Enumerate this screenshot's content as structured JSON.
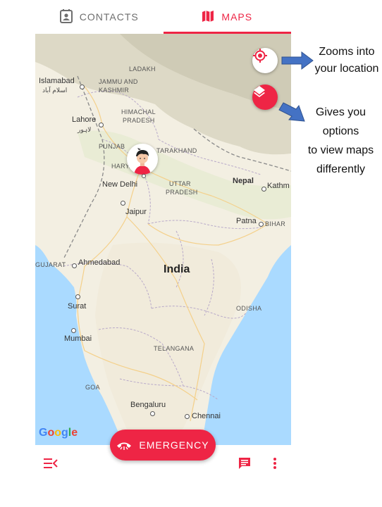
{
  "tabs": [
    {
      "label": "CONTACTS",
      "icon": "contacts-icon"
    },
    {
      "label": "MAPS",
      "icon": "map-icon",
      "active": true
    }
  ],
  "map": {
    "labels": {
      "ladakh": "LADAKH",
      "jammu_kashmir_1": "JAMMU AND",
      "jammu_kashmir_2": "KASHMIR",
      "islamabad": "Islamabad",
      "islamabad_urdu": "اسلام آباد",
      "lahore": "Lahore",
      "lahore_urdu": "لاہور",
      "himachal_1": "HIMACHAL",
      "himachal_2": "PRADESH",
      "punjab": "PUNJAB",
      "uttarakhand": "TARAKHAND",
      "haryana": "HARYA",
      "new_delhi": "New Delhi",
      "uttar_1": "UTTAR",
      "uttar_2": "PRADESH",
      "nepal": "Nepal",
      "kathmandu": "Kathm",
      "jaipur": "Jaipur",
      "patna": "Patna",
      "bihar": "BIHAR",
      "gujarat": "GUJARAT",
      "ahmedabad": "Ahmedabad",
      "india": "India",
      "surat": "Surat",
      "odisha": "ODISHA",
      "mumbai": "Mumbai",
      "telangana": "TELANGANA",
      "goa": "GOA",
      "bengaluru": "Bengaluru",
      "chennai": "Chennai"
    },
    "google_logo": [
      "G",
      "o",
      "o",
      "g",
      "l",
      "e"
    ],
    "google_colors": [
      "#4285F4",
      "#EA4335",
      "#FBBC05",
      "#4285F4",
      "#34A853",
      "#EA4335"
    ]
  },
  "buttons": {
    "my_location_icon": "crosshair-icon",
    "layers_icon": "layers-icon",
    "emergency_label": "EMERGENCY",
    "emergency_icon": "phone-hangup-icon",
    "menu_icon": "menu-collapse-icon",
    "chat_icon": "chat-icon",
    "more_icon": "more-vert-icon"
  },
  "annotations": {
    "location_1": "Zooms into",
    "location_2": "your location",
    "layers_1": "Gives you",
    "layers_2": "options",
    "layers_3": "to view maps",
    "layers_4": "differently"
  },
  "colors": {
    "accent": "#ee2545",
    "arrow": "#4472c4",
    "water": "#aadaff",
    "land": "#f3efe2"
  }
}
